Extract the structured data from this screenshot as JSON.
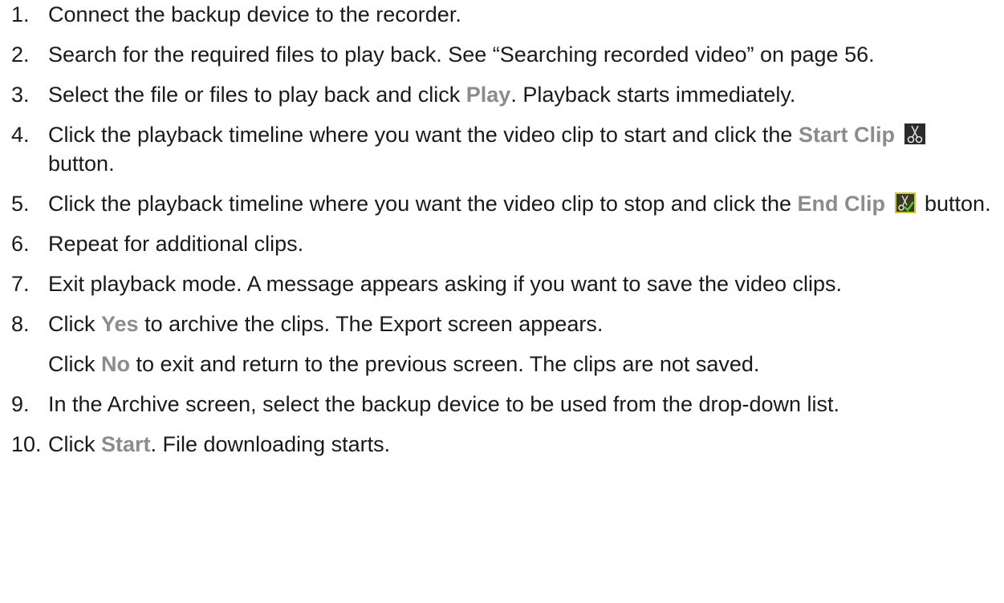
{
  "steps": [
    {
      "num": "1.",
      "text": "Connect the backup device to the recorder."
    },
    {
      "num": "2.",
      "text": "Search for the required files to play back. See “Searching recorded video” on page 56."
    },
    {
      "num": "3.",
      "pre": "Select the file or files to play back and click ",
      "bold": "Play",
      "post": ". Playback starts immediately."
    },
    {
      "num": "4.",
      "pre": "Click the playback timeline where you want the video clip to start and click the ",
      "bold": "Start Clip",
      "icon": "scissors-icon",
      "post": " button."
    },
    {
      "num": "5.",
      "pre": "Click the playback timeline where you want the video clip to stop and click the ",
      "bold": "End Clip",
      "icon": "scissors-check-icon",
      "post": " button."
    },
    {
      "num": "6.",
      "text": "Repeat for additional clips."
    },
    {
      "num": "7.",
      "text": "Exit playback mode. A message appears asking if you want to save the video clips."
    },
    {
      "num": "8.",
      "pre": "Click ",
      "bold": "Yes",
      "post": " to archive the clips. The Export screen appears.",
      "extra": {
        "pre": "Click ",
        "bold": "No",
        "post": " to exit and return to the previous screen. The clips are not saved."
      }
    },
    {
      "num": "9.",
      "text": "In the Archive screen, select the backup device to be used from the drop-down list."
    },
    {
      "num": "10.",
      "pre": "Click ",
      "bold": "Start",
      "post": ". File downloading starts."
    }
  ],
  "colors": {
    "text": "#1a1a1a",
    "keyword": "#8c8c8c"
  }
}
